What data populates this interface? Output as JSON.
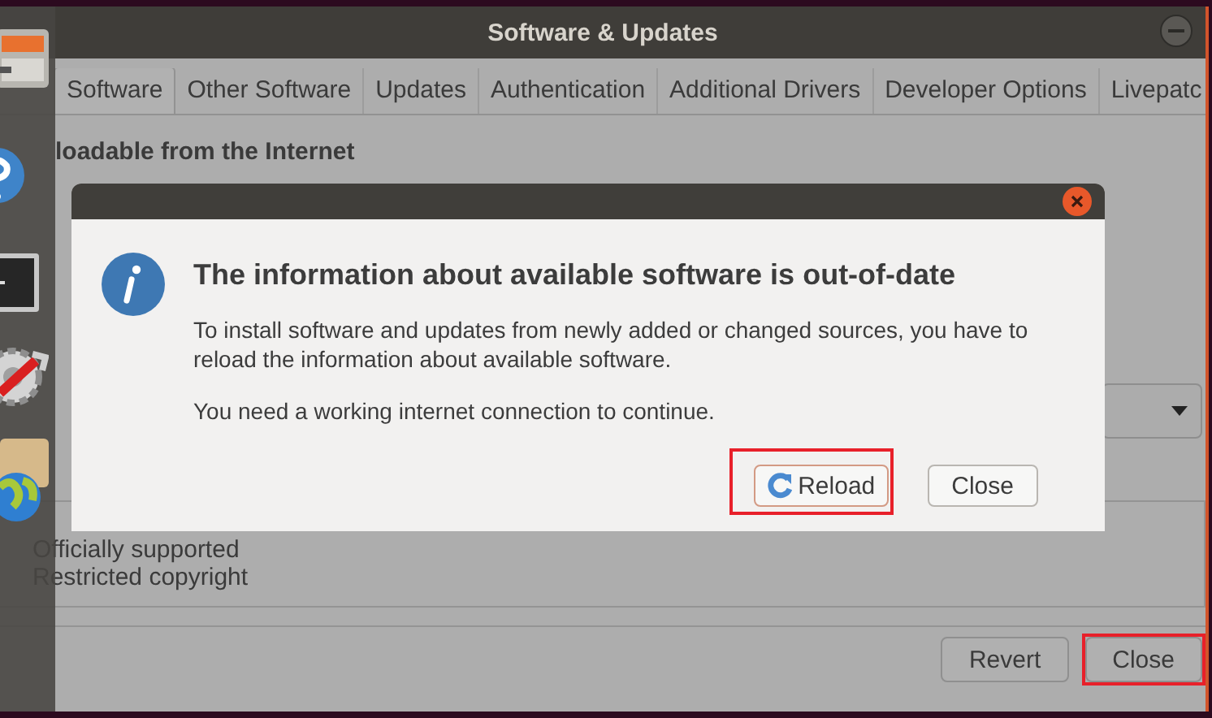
{
  "window": {
    "title": "Software & Updates"
  },
  "tabs": [
    {
      "label": "Software",
      "selected": true
    },
    {
      "label": "Other Software",
      "selected": false
    },
    {
      "label": "Updates",
      "selected": false
    },
    {
      "label": "Authentication",
      "selected": false
    },
    {
      "label": "Additional Drivers",
      "selected": false
    },
    {
      "label": "Developer Options",
      "selected": false
    },
    {
      "label": "Livepatc",
      "selected": false
    }
  ],
  "section": {
    "heading": "loadable from the Internet"
  },
  "options": [
    "Officially supported",
    "Restricted copyright"
  ],
  "buttons": [
    {
      "label": "Revert",
      "highlighted": false
    },
    {
      "label": "Close",
      "highlighted": true
    }
  ],
  "dialog": {
    "title": "The information about available software is out-of-date",
    "message": "To install software and updates from newly added or changed sources, you have to reload the information about available software.",
    "note": "You need a working internet connection to continue.",
    "buttons": [
      {
        "label": "Reload",
        "kind": "reload",
        "highlighted": true
      },
      {
        "label": "Close",
        "kind": "plain",
        "highlighted": false
      }
    ]
  }
}
